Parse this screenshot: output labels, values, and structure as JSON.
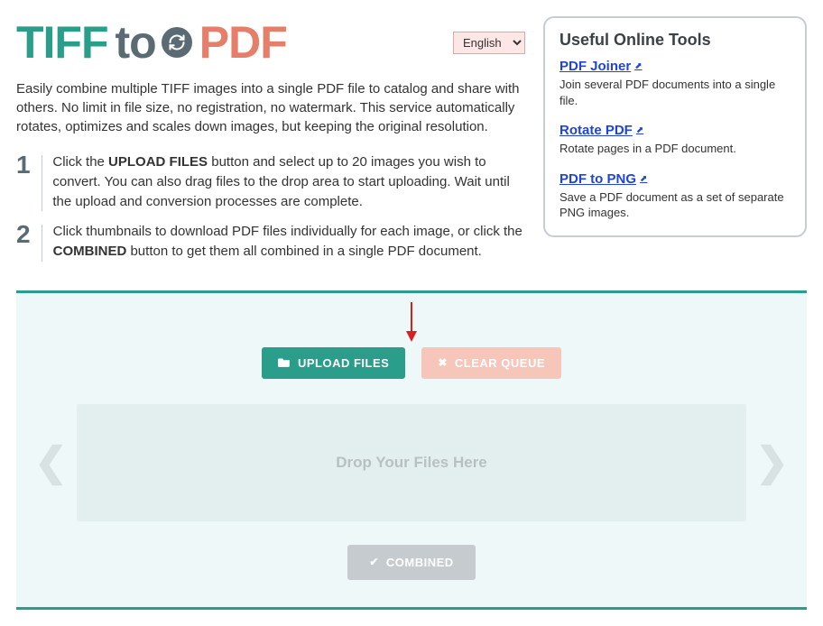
{
  "logo": {
    "tiff": "TIFF",
    "to": "to",
    "pdf": "PDF"
  },
  "language": {
    "selected": "English"
  },
  "description": "Easily combine multiple TIFF images into a single PDF file to catalog and share with others. No limit in file size, no registration, no watermark. This service automatically rotates, optimizes and scales down images, but keeping the original resolution.",
  "steps": [
    {
      "num": "1",
      "prefix": "Click the ",
      "bold1": "UPLOAD FILES",
      "suffix": " button and select up to 20 images you wish to convert. You can also drag files to the drop area to start uploading. Wait until the upload and conversion processes are complete."
    },
    {
      "num": "2",
      "prefix": "Click thumbnails to download PDF files individually for each image, or click the ",
      "bold1": "COMBINED",
      "suffix": " button to get them all combined in a single PDF document."
    }
  ],
  "sidebar": {
    "title": "Useful Online Tools",
    "tools": [
      {
        "name": "PDF Joiner",
        "desc": "Join several PDF documents into a single file."
      },
      {
        "name": "Rotate PDF",
        "desc": "Rotate pages in a PDF document."
      },
      {
        "name": "PDF to PNG",
        "desc": "Save a PDF document as a set of separate PNG images."
      }
    ]
  },
  "buttons": {
    "upload": "UPLOAD FILES",
    "clear": "CLEAR QUEUE",
    "combined": "COMBINED"
  },
  "dropzone": "Drop Your Files Here"
}
